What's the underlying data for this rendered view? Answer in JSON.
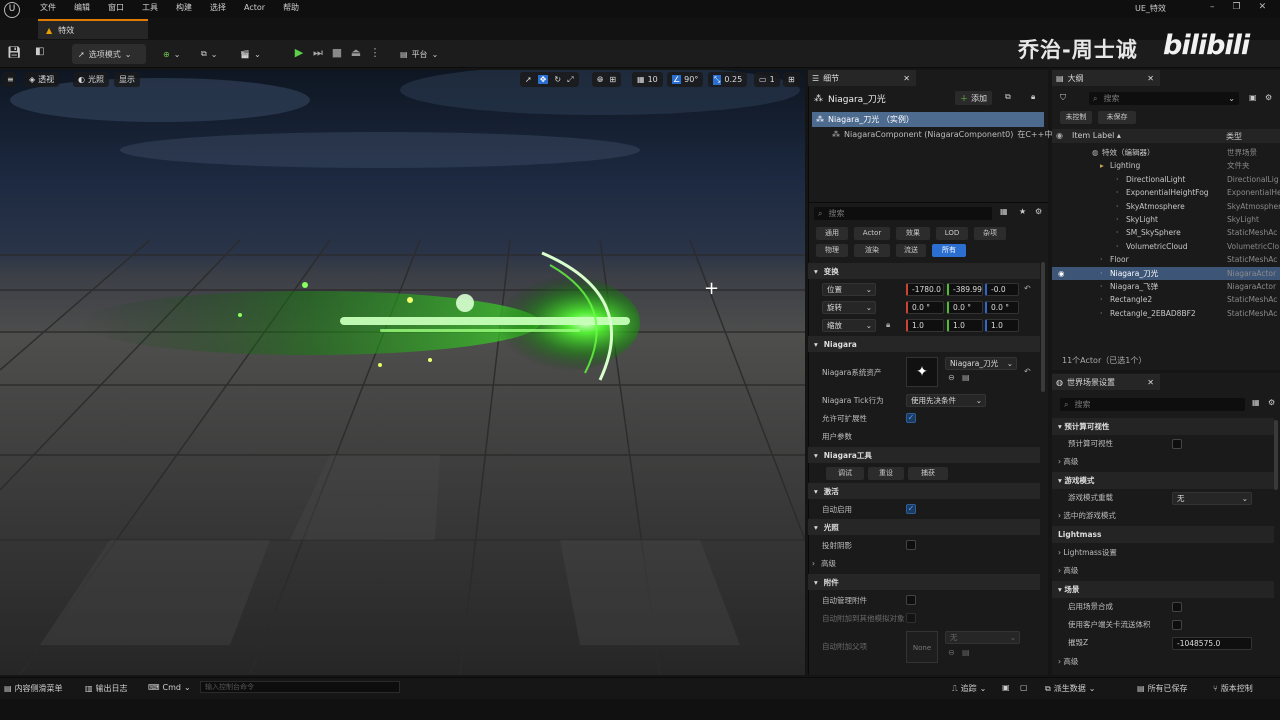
{
  "menu": [
    "文件",
    "编辑",
    "窗口",
    "工具",
    "构建",
    "选择",
    "Actor",
    "帮助"
  ],
  "project_name": "UE_特效",
  "level_tab": "特效",
  "toolbar": {
    "mode": "选项模式",
    "platform": "平台"
  },
  "watermark": {
    "author": "乔治-周士诚",
    "site": "bilibili"
  },
  "viewport": {
    "perspective": "透视",
    "lit": "光照",
    "show": "显示",
    "grid_snap": "10",
    "rotate_snap": "90°",
    "scale_snap": "0.25",
    "camera_speed": "1"
  },
  "details": {
    "tab_title": "细节",
    "actor_name": "Niagara_刀光",
    "add_label": "添加",
    "instance_label": "Niagara_刀光 （实例）",
    "component_label": "NiagaraComponent (NiagaraComponent0)",
    "component_suffix": "在C++中",
    "search_placeholder": "搜索",
    "filters_row1": [
      "通用",
      "Actor",
      "效果",
      "LOD",
      "杂项"
    ],
    "filters_row2": [
      "物理",
      "渲染",
      "流送",
      "所有"
    ],
    "transform": {
      "header": "变换",
      "location_label": "位置",
      "rotation_label": "旋转",
      "scale_label": "缩放",
      "location": [
        "-1780.0",
        "-389.99",
        "-0.0"
      ],
      "rotation": [
        "0.0 °",
        "0.0 °",
        "0.0 °"
      ],
      "scale": [
        "1.0",
        "1.0",
        "1.0"
      ]
    },
    "niagara": {
      "header": "Niagara",
      "system_asset_label": "Niagara系统资产",
      "system_asset_value": "Niagara_刀光",
      "tick_label": "Niagara Tick行为",
      "tick_value": "使用先决条件",
      "allow_scalability_label": "允许可扩展性",
      "user_params_label": "用户参数"
    },
    "tools": {
      "header": "Niagara工具",
      "buttons": [
        "调试",
        "重设",
        "捕获"
      ]
    },
    "activation": {
      "header": "激活",
      "auto_activate_label": "自动启用"
    },
    "lighting": {
      "header": "光照",
      "cast_shadow_label": "投射阴影",
      "advanced_label": "高级"
    },
    "attachment": {
      "header": "附件",
      "auto_manage_label": "自动管理附件",
      "auto_attach_label": "自动附加到其他模拟对象",
      "auto_parent_label": "自动附加父项",
      "none_label": "None",
      "none_value": "无"
    }
  },
  "outliner": {
    "title": "大纲",
    "search_placeholder": "搜索",
    "btn_uncontrolled": "未控制",
    "btn_unsaved": "未保存",
    "col_label": "Item Label ▴",
    "col_type": "类型",
    "items": [
      {
        "name": "特效（编辑器）",
        "type": "世界场景",
        "indent": 0
      },
      {
        "name": "Lighting",
        "type": "文件夹",
        "indent": 1
      },
      {
        "name": "DirectionalLight",
        "type": "DirectionalLig",
        "indent": 2
      },
      {
        "name": "ExponentialHeightFog",
        "type": "ExponentialHe",
        "indent": 2
      },
      {
        "name": "SkyAtmosphere",
        "type": "SkyAtmosphere",
        "indent": 2
      },
      {
        "name": "SkyLight",
        "type": "SkyLight",
        "indent": 2
      },
      {
        "name": "SM_SkySphere",
        "type": "StaticMeshAc",
        "indent": 2
      },
      {
        "name": "VolumetricCloud",
        "type": "VolumetricClo",
        "indent": 2
      },
      {
        "name": "Floor",
        "type": "StaticMeshAc",
        "indent": 1
      },
      {
        "name": "Niagara_刀光",
        "type": "NiagaraActor",
        "indent": 1
      },
      {
        "name": "Niagara_飞弹",
        "type": "NiagaraActor",
        "indent": 1
      },
      {
        "name": "Rectangle2",
        "type": "StaticMeshAc",
        "indent": 1
      },
      {
        "name": "Rectangle_2EBAD8BF2",
        "type": "StaticMeshAc",
        "indent": 1
      }
    ],
    "count": "11个Actor（已选1个）"
  },
  "world_settings": {
    "title": "世界场景设置",
    "search_placeholder": "搜索",
    "precompute_header": "预计算可视性",
    "precompute_label": "预计算可视性",
    "advanced_label": "高级",
    "gamemode_header": "游戏模式",
    "gamemode_override_label": "游戏模式重载",
    "gamemode_override_value": "无",
    "selected_gamemode_label": "选中的游戏模式",
    "lightmass_header": "Lightmass",
    "lightmass_settings_label": "Lightmass设置",
    "world_header": "场景",
    "enable_composition_label": "启用场景合成",
    "client_streaming_label": "使用客户端关卡流送体积",
    "kill_z_label": "摧毁Z",
    "kill_z_value": "-1048575.0"
  },
  "status": {
    "content_drawer": "内容侧滑菜单",
    "output_log": "输出日志",
    "cmd": "Cmd",
    "console_placeholder": "输入控制台命令",
    "trace": "追踪",
    "derived_data": "派生数据",
    "all_saved": "所有已保存",
    "source_control": "版本控制"
  }
}
